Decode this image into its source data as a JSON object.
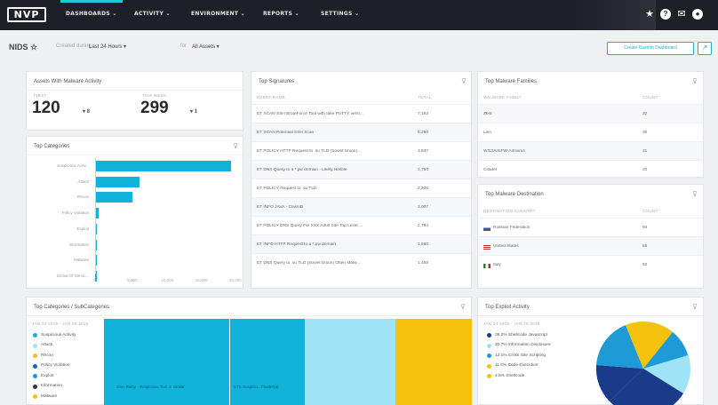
{
  "nav": {
    "logo": "NVP",
    "items": [
      "DASHBOARDS ⌄",
      "ACTIVITY ⌄",
      "ENVIRONMENT ⌄",
      "REPORTS ⌄",
      "SETTINGS ⌄"
    ]
  },
  "filter": {
    "title": "NIDS ☆",
    "created_label": "Created during",
    "created_value": "Last 24 Hours ▾",
    "for_label": "for",
    "for_value": "All Assets ▾",
    "create_button": "Create Custom Dashboard",
    "share_icon": "↗"
  },
  "assets_panel": {
    "title": "Assets With Malware Activity",
    "first_label": "FIRST",
    "first_value": "120",
    "first_delta": "▾ 8",
    "second_label": "THIS WEEK",
    "second_value": "299",
    "second_delta": "▾ 1"
  },
  "top_categories": {
    "title": "Top Categories",
    "filter_icon": "⊽",
    "labels": [
      "Suspicious Activ...",
      "Attack",
      "Recon",
      "Policy Violation",
      "Exploit",
      "Information",
      "Malware",
      "Denial Of Servic..."
    ],
    "ticks": [
      "0",
      "5,000",
      "10,000",
      "15,000",
      "20,000"
    ]
  },
  "chart_data": {
    "type": "bar",
    "categories": [
      "Suspicious Activ...",
      "Attack",
      "Recon",
      "Policy Violation",
      "Exploit",
      "Information",
      "Malware",
      "Denial Of Servic..."
    ],
    "values": [
      20000,
      6500,
      5500,
      500,
      300,
      250,
      200,
      100
    ],
    "xlim": [
      0,
      20000
    ],
    "title": "Top Categories"
  },
  "top_signatures": {
    "title": "Top Signatures",
    "filter_icon": "⊽",
    "col_name": "EVENT NAME",
    "col_total": "TOTAL",
    "rows": [
      {
        "name": "ET SCAN SSH BruteForce Tool with fake PUTTY versi...",
        "total": "7,153"
      },
      {
        "name": "ET SCAN Potential SSH Scan",
        "total": "5,296"
      },
      {
        "name": "ET POLICY HTTP Request to .su TLD (Soviet Union)...",
        "total": "3,837"
      },
      {
        "name": "ET DNS Query to a *.pw domain - Likely Hostile",
        "total": "2,750"
      },
      {
        "name": "ET POLICY Request to .su TLD",
        "total": "2,305"
      },
      {
        "name": "ET INFO JAVA - ClassID",
        "total": "2,007"
      },
      {
        "name": "ET POLICY DNS Query For XXX Adult Site Top Level ...",
        "total": "1,794"
      },
      {
        "name": "ET INFO HTTP Request to a *.pw domain",
        "total": "1,586"
      },
      {
        "name": "ET DNS Query to .su TLD (Soviet Union) Often Malw...",
        "total": "1,468"
      }
    ]
  },
  "top_malware_families": {
    "title": "Top Malware Families",
    "filter_icon": "⊽",
    "col_name": "MALWARE FAMILY",
    "col_count": "COUNT",
    "rows": [
      {
        "name": "Zbot",
        "count": "32"
      },
      {
        "name": "Lien",
        "count": "30"
      },
      {
        "name": "W32/AntiFW-Antivirus",
        "count": "31"
      },
      {
        "name": "Citadel",
        "count": "20"
      }
    ]
  },
  "top_malware_destination": {
    "title": "Top Malware Destination",
    "filter_icon": "⊽",
    "col_name": "DESTINATION COUNTRY",
    "col_count": "COUNT",
    "rows": [
      {
        "name": "Russian Federation",
        "count": "94"
      },
      {
        "name": "United States",
        "count": "56"
      },
      {
        "name": "Italy",
        "count": "50"
      }
    ]
  },
  "subcategories": {
    "title": "Top Categories / SubCategories",
    "filter_icon": "⊽",
    "date_range": "JAN 24 2018 - JAN 25 2018",
    "legend": [
      {
        "label": "Suspicious Activity",
        "color": "#12b3da"
      },
      {
        "label": "Attack",
        "color": "#9fe3f7"
      },
      {
        "label": "Recon",
        "color": "#f4c20d"
      },
      {
        "label": "Policy Violation",
        "color": "#1565c0"
      },
      {
        "label": "Exploit",
        "color": "#1e9bd7"
      },
      {
        "label": "Information",
        "color": "#333333"
      },
      {
        "label": "Malware",
        "color": "#f4c20d"
      }
    ],
    "tile1": "SSH Rainy - Suspicious Tool or similar",
    "tile2": "STS Suspicio...Cluster(a)"
  },
  "exploit_activity": {
    "title": "Top Exploit Activity",
    "filter_icon": "⊽",
    "date_range": "JAN 24 2018 - JAN 25 2018",
    "legend": [
      {
        "label": "38.2% Shellcode Javascript",
        "color": "#1a3a8a"
      },
      {
        "label": "30.7% Information Disclosure",
        "color": "#9fe3f7"
      },
      {
        "label": "12.1% Cross Site Scripting",
        "color": "#1e9bd7"
      },
      {
        "label": "11.6% Code Execution",
        "color": "#f4c20d"
      },
      {
        "label": "4.5% Shellcode",
        "color": "#f4c20d"
      }
    ]
  }
}
